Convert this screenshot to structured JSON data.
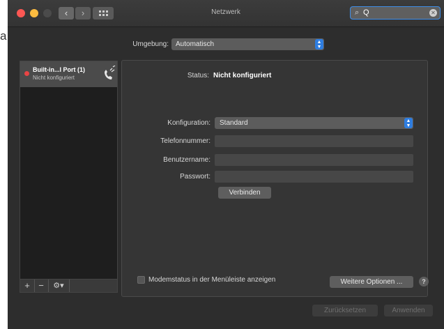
{
  "background": {
    "side_text": "a"
  },
  "window": {
    "title": "Netzwerk",
    "search_value": "Q"
  },
  "toolbar": {
    "back_glyph": "‹",
    "forward_glyph": "›"
  },
  "location": {
    "label": "Umgebung:",
    "value": "Automatisch"
  },
  "services": [
    {
      "name": "Built-in...l Port (1)",
      "status": "Nicht konfiguriert",
      "status_color": "#e84444",
      "icon": "phone-icon"
    }
  ],
  "sidebar_tools": {
    "add": "+",
    "remove": "−",
    "gear": "⚙▾"
  },
  "detail": {
    "status_label": "Status:",
    "status_value": "Nicht konfiguriert",
    "config_label": "Konfiguration:",
    "config_value": "Standard",
    "phone_label": "Telefonnummer:",
    "phone_value": "",
    "user_label": "Benutzername:",
    "user_value": "",
    "password_label": "Passwort:",
    "password_value": "",
    "connect_label": "Verbinden"
  },
  "footer": {
    "modem_status_label": "Modemstatus in der Menüleiste anzeigen",
    "modem_status_checked": false,
    "more_options_label": "Weitere Optionen ...",
    "help_label": "?",
    "revert_label": "Zurücksetzen",
    "apply_label": "Anwenden"
  },
  "colors": {
    "accent": "#2e7de0",
    "window_bg": "#2d2d2d",
    "close": "#fc5753",
    "minimize": "#fdbc40"
  }
}
